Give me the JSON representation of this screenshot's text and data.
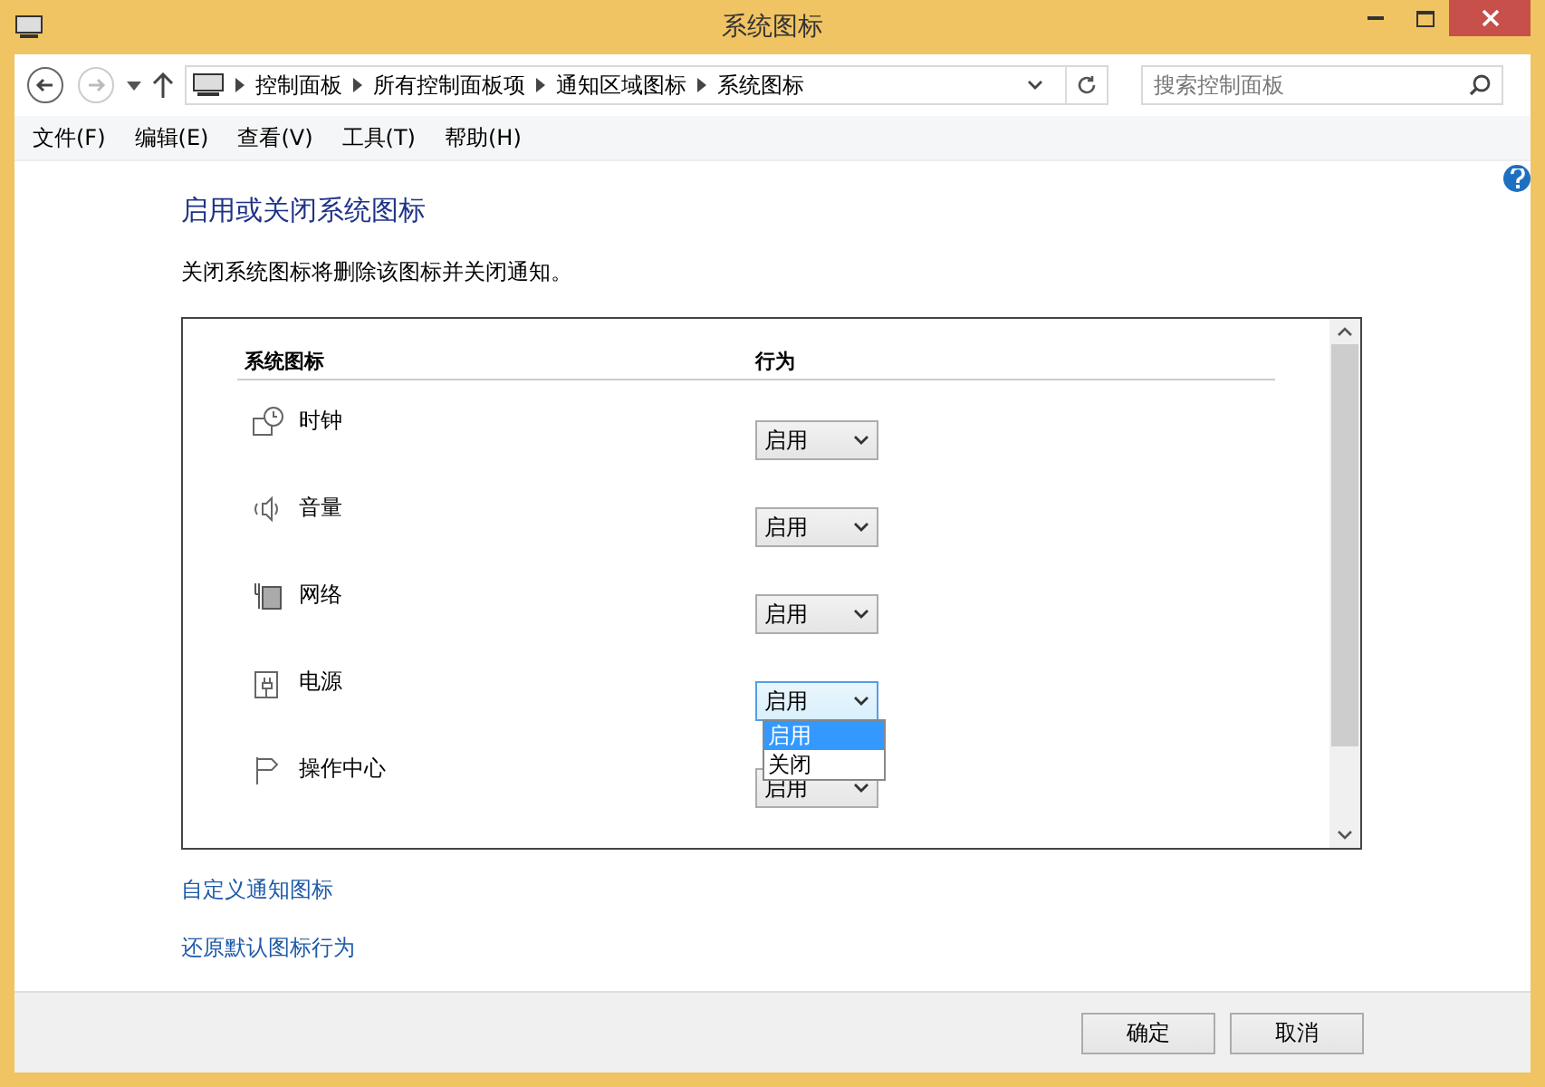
{
  "window": {
    "title": "系统图标"
  },
  "breadcrumb": [
    "控制面板",
    "所有控制面板项",
    "通知区域图标",
    "系统图标"
  ],
  "search": {
    "placeholder": "搜索控制面板"
  },
  "menu": [
    "文件(F)",
    "编辑(E)",
    "查看(V)",
    "工具(T)",
    "帮助(H)"
  ],
  "heading": "启用或关闭系统图标",
  "description": "关闭系统图标将删除该图标并关闭通知。",
  "table": {
    "columns": [
      "系统图标",
      "行为"
    ],
    "rows": [
      {
        "kind": "clock",
        "name": "时钟",
        "value": "启用",
        "expanded": false
      },
      {
        "kind": "volume",
        "name": "音量",
        "value": "启用",
        "expanded": false
      },
      {
        "kind": "network",
        "name": "网络",
        "value": "启用",
        "expanded": false
      },
      {
        "kind": "power",
        "name": "电源",
        "value": "启用",
        "expanded": true,
        "options": [
          {
            "label": "启用",
            "selected": true
          },
          {
            "label": "关闭",
            "selected": false
          }
        ]
      },
      {
        "kind": "flag",
        "name": "操作中心",
        "value": "启用",
        "expanded": false
      }
    ]
  },
  "links": [
    "自定义通知图标",
    "还原默认图标行为"
  ],
  "buttons": [
    "确定",
    "取消"
  ]
}
